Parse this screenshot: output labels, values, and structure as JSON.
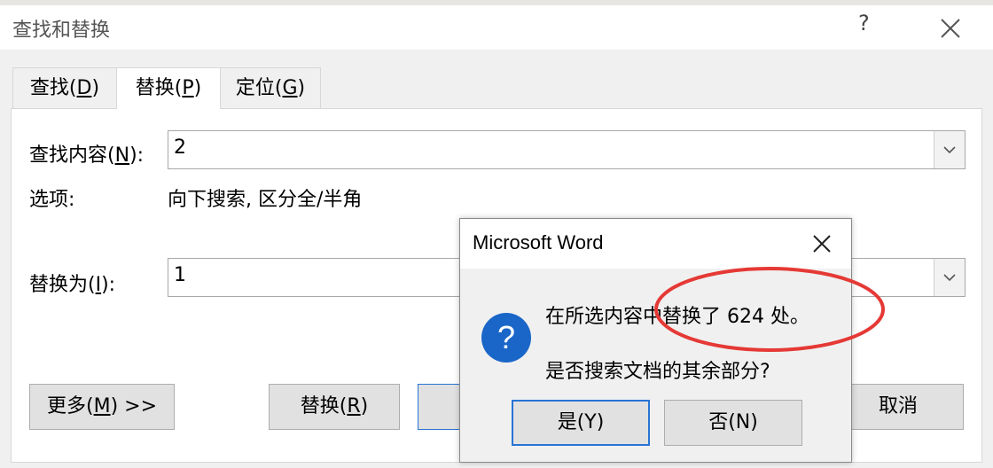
{
  "dialog": {
    "title": "查找和替换",
    "help_glyph": "?",
    "tabs": [
      {
        "label": "查找(",
        "key": "D",
        "suffix": ")"
      },
      {
        "label": "替换(",
        "key": "P",
        "suffix": ")"
      },
      {
        "label": "定位(",
        "key": "G",
        "suffix": ")"
      }
    ],
    "find": {
      "label": "查找内容(",
      "key": "N",
      "suffix": "):",
      "value": "2"
    },
    "options": {
      "label": "选项:",
      "value": "向下搜索, 区分全/半角"
    },
    "replace": {
      "label": "替换为(",
      "key": "I",
      "suffix": "):",
      "value": "1"
    },
    "buttons": {
      "more": {
        "label": "更多(",
        "key": "M",
        "suffix": ") >>"
      },
      "replace": {
        "label": "替换(",
        "key": "R",
        "suffix": ")"
      },
      "cancel": "取消"
    }
  },
  "message_box": {
    "title": "Microsoft Word",
    "line1": "在所选内容中替换了 624 处。",
    "line2": "是否搜索文档的其余部分?",
    "yes": "是(Y)",
    "no": "否(N)"
  },
  "colors": {
    "accent": "#2874d6",
    "annotation_red": "#e53935",
    "question_icon": "#1a66c8"
  }
}
